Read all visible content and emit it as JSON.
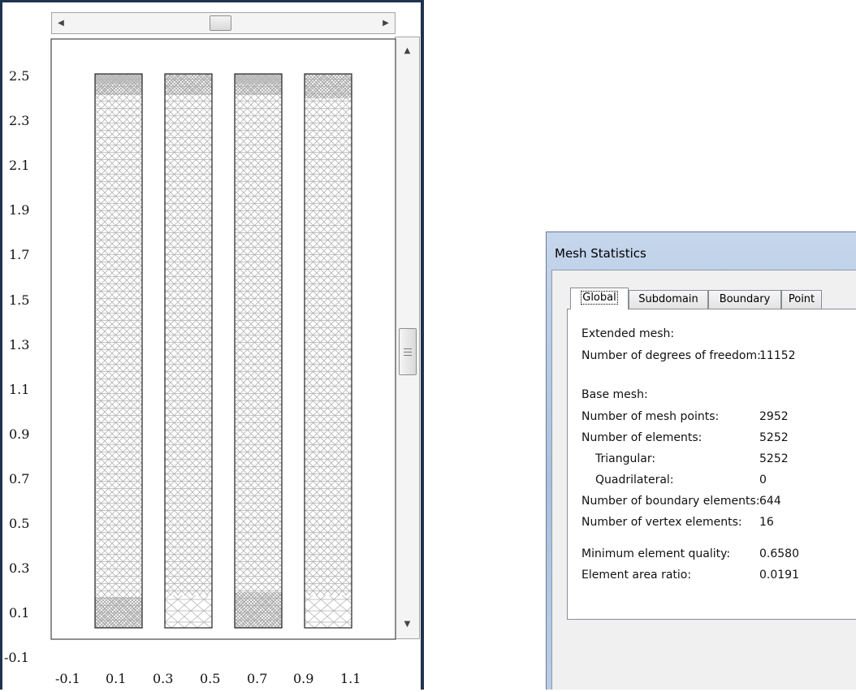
{
  "plot": {
    "y_ticks": [
      "2.5",
      "2.3",
      "2.1",
      "1.9",
      "1.7",
      "1.5",
      "1.3",
      "1.1",
      "0.9",
      "0.7",
      "0.5",
      "0.3",
      "0.1",
      "-0.1"
    ],
    "x_ticks": [
      "-0.1",
      "0.1",
      "0.3",
      "0.5",
      "0.7",
      "0.9",
      "1.1"
    ],
    "mesh_color": "#b4b4b4",
    "outline_color": "#222222",
    "scrollbar_up_icon": "up-arrow",
    "scrollbar_down_icon": "down-arrow"
  },
  "dialog": {
    "title": "Mesh Statistics",
    "tabs": [
      {
        "label": "Global",
        "active": true
      },
      {
        "label": "Subdomain"
      },
      {
        "label": "Boundary"
      },
      {
        "label": "Point"
      }
    ],
    "extended_heading": "Extended mesh:",
    "dof_label": "Number of degrees of freedom:",
    "dof_value": "11152",
    "base_heading": "Base mesh:",
    "mesh_points_label": "Number of mesh points:",
    "mesh_points_value": "2952",
    "elements_label": "Number of elements:",
    "elements_value": "5252",
    "triangular_label": "Triangular:",
    "triangular_value": "5252",
    "quad_label": "Quadrilateral:",
    "quad_value": "0",
    "boundary_label": "Number of boundary elements:",
    "boundary_value": "644",
    "vertex_label": "Number of vertex elements:",
    "vertex_value": "16",
    "quality_label": "Minimum element quality:",
    "quality_value": "0.6580",
    "area_label": "Element area ratio:",
    "area_value": "0.0191"
  }
}
